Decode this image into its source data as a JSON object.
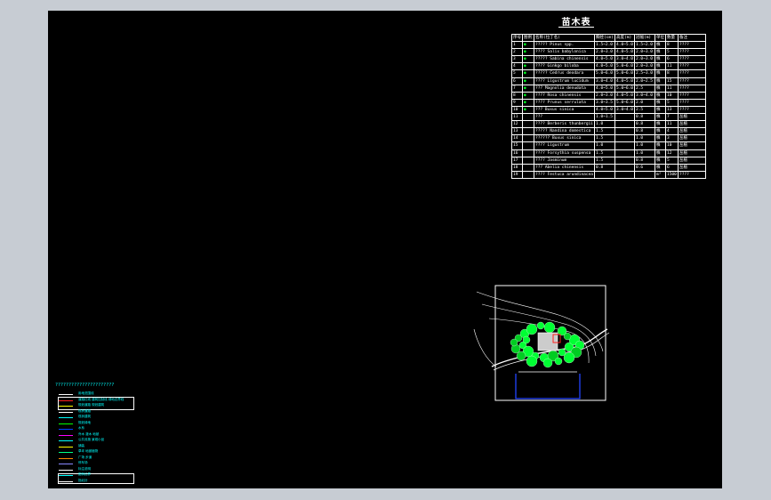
{
  "title": "苗木表",
  "table": {
    "header": [
      "序号",
      "图例",
      "名称(拉丁名)",
      "胸径(cm)",
      "高度(m)",
      "冠幅(m)",
      "单位",
      "数量",
      "备注"
    ],
    "rows": [
      [
        "1",
        "●",
        "????? Pinus spp.",
        "1.5~2.0",
        "4.0~5.0",
        "1.5~2.0",
        "株",
        "8",
        "????"
      ],
      [
        "2",
        "●",
        "???? Salix babylonica",
        "2.0~3.0",
        "4.0~5.0",
        "2.0~3.0",
        "株",
        "5",
        "????"
      ],
      [
        "3",
        "●",
        "????? Sabina chinensis",
        "4.0~5.0",
        "3.0~4.0",
        "2.0~3.0",
        "株",
        "6",
        "????"
      ],
      [
        "4",
        "●",
        "???? Ginkgo biloba",
        "4.0~5.0",
        "5.0~6.0",
        "2.0~3.0",
        "株",
        "11",
        "????"
      ],
      [
        "5",
        "●",
        "????? Cedrus deodara",
        "5.0~6.0",
        "5.0~6.0",
        "2.5~3.0",
        "株",
        "8",
        "????"
      ],
      [
        "6",
        "●",
        "???? Ligustrum lucidum",
        "3.0~4.0",
        "4.0~5.0",
        "2.0~2.5",
        "株",
        "15",
        "????"
      ],
      [
        "7",
        "●",
        "??? Magnolia denudata",
        "4.0~5.0",
        "5.0~6.0",
        "2.5",
        "株",
        "11",
        "????"
      ],
      [
        "8",
        "●",
        "???? Rosa chinensis",
        "2.0~3.0",
        "4.0~5.0",
        "3.0~4.0",
        "株",
        "10",
        "????"
      ],
      [
        "9",
        "●",
        "???? Prunus serrulata",
        "3.0~3.5",
        "5.0~6.0",
        "2.0",
        "株",
        "5",
        "????"
      ],
      [
        "10",
        "●",
        "??? Buxus sinica",
        "4.0~5.0",
        "3.0~4.0",
        "2.5",
        "株",
        "13",
        "????"
      ],
      [
        "11",
        "",
        "???",
        "1.0~1.5",
        "",
        "0.8",
        "株",
        "7",
        "丛植"
      ],
      [
        "12",
        "",
        "???? Berberis thunbergii",
        "1.0",
        "",
        "0.8",
        "株",
        "11",
        "丛植"
      ],
      [
        "13",
        "",
        "????? Nandina domestica",
        "1.5",
        "",
        "0.8",
        "株",
        "4",
        "丛植"
      ],
      [
        "14",
        "",
        "?????? Buxus sinica",
        "1.5",
        "",
        "1.0",
        "株",
        "3",
        "丛植"
      ],
      [
        "15",
        "",
        "???? Ligustrum",
        "1.0",
        "",
        "1.0",
        "株",
        "10",
        "丛植"
      ],
      [
        "16",
        "",
        "???? Forsythia suspensa",
        "1.5",
        "",
        "1.0",
        "株",
        "12",
        "丛植"
      ],
      [
        "17",
        "",
        "???? Jasminum",
        "1.5",
        "",
        "0.8",
        "株",
        "5",
        "丛植"
      ],
      [
        "18",
        "",
        "??? Abelia chinensis",
        "0.8",
        "",
        "0.6",
        "株",
        "6",
        "丛植"
      ],
      [
        "19",
        "",
        "???? Festuca arundinacea",
        "",
        "",
        "",
        "m²",
        "1500",
        "????"
      ]
    ]
  },
  "legend": {
    "title": "??????????????????????",
    "items": [
      {
        "label": "用地范围线",
        "color": "#ffffff"
      },
      {
        "label": "道路红线 建筑控制线 绿地边界线",
        "color": "#ff2020"
      },
      {
        "label": "规划道路 规划建筑",
        "color": "#ffff00"
      },
      {
        "label": "现状道路",
        "color": "#ffffff"
      },
      {
        "label": "现状建筑",
        "color": "#00ffff"
      },
      {
        "label": "规划绿地",
        "color": "#00ff00"
      },
      {
        "label": "水系",
        "color": "#0044ff"
      },
      {
        "label": "乔木 灌木 地被",
        "color": "#ff00ff"
      },
      {
        "label": "公共设施 景观小品",
        "color": "#00ffff"
      },
      {
        "label": "铺装",
        "color": "#ffff00"
      },
      {
        "label": "草坪 地被植物",
        "color": "#00ff88"
      },
      {
        "label": "广场 步道",
        "color": "#ff8800"
      },
      {
        "label": "停车场",
        "color": "#8888ff"
      },
      {
        "label": "标注说明",
        "color": "#ffffff"
      },
      {
        "label": "图例边界",
        "color": "#00ffff"
      },
      {
        "label": "指北针",
        "color": "#ffffff"
      }
    ]
  }
}
